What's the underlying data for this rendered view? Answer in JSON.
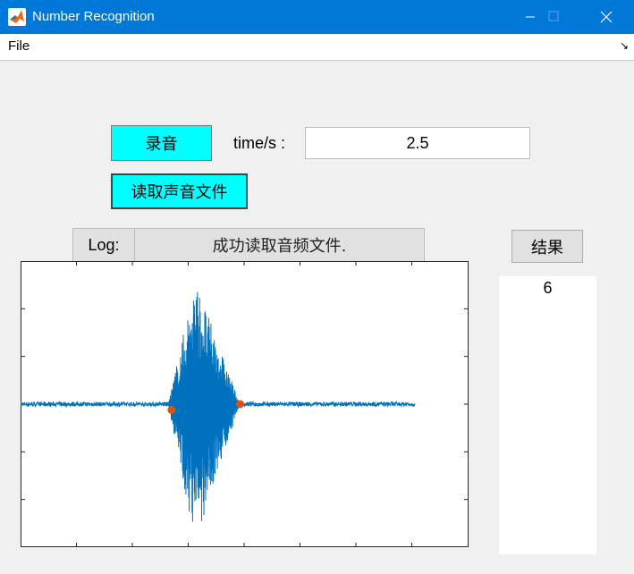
{
  "window": {
    "title": "Number Recognition"
  },
  "menu": {
    "file_label": "File"
  },
  "controls": {
    "record_label": "录音",
    "time_label": "time/s :",
    "time_value": "2.5",
    "read_file_label": "读取声音文件",
    "log_label": "Log:",
    "log_message": "成功读取音频文件.",
    "result_button_label": "结果",
    "result_value": "6"
  },
  "colors": {
    "titlebar": "#0078d7",
    "accent_button": "#00ffff",
    "waveform": "#0072bd",
    "marker": "#d95319"
  },
  "chart_data": {
    "type": "line",
    "title": "",
    "xlabel": "",
    "ylabel": "",
    "grid": false,
    "xlim": [
      0,
      1
    ],
    "ylim": [
      -1,
      1
    ],
    "description_free": true,
    "signal": {
      "length": 0.88,
      "baseline": 0.0,
      "burst_start": 0.33,
      "burst_peak": 0.39,
      "burst_end": 0.49,
      "peak_amplitude_pos": 0.87,
      "peak_amplitude_neg": -0.97
    },
    "markers": [
      {
        "x": 0.337,
        "y": -0.04
      },
      {
        "x": 0.49,
        "y": 0.0
      }
    ]
  }
}
